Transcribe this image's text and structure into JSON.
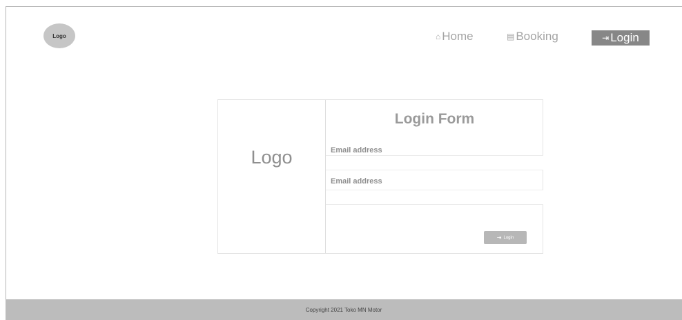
{
  "header": {
    "logo_text": "Logo",
    "nav": {
      "home_icon": "home-icon",
      "home_label": "Home",
      "booking_icon": "clipboard-icon",
      "booking_label": "Booking",
      "login_icon": "login-icon",
      "login_label": "Login"
    }
  },
  "card": {
    "logo_text": "Logo",
    "form_title": "Login Form",
    "fields": [
      {
        "label": "Email address",
        "value": ""
      },
      {
        "label": "Email address",
        "value": ""
      }
    ],
    "button_label": "Login",
    "button_icon": "login-icon"
  },
  "footer": {
    "copyright": "Copyright 2021 Toko MN Motor"
  },
  "colors": {
    "active_nav_bg": "#878787",
    "footer_bg": "#bcbcbc",
    "logo_circle": "#c6c6c6"
  }
}
